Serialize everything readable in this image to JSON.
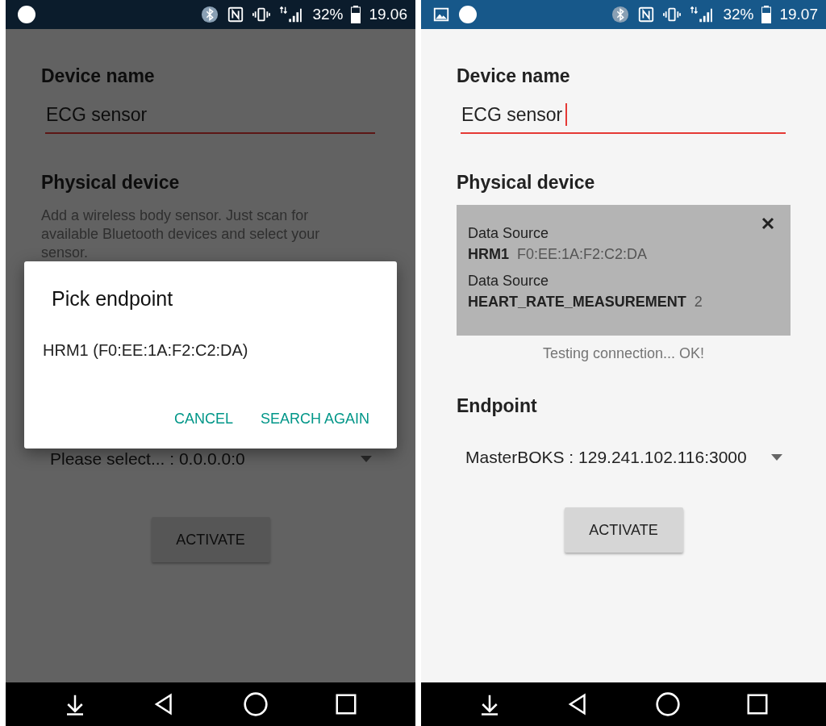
{
  "screens": [
    {
      "dimmed": true,
      "status_bar": {
        "notification_icons": [
          {
            "kind": "circle"
          }
        ],
        "battery": "32%",
        "time": "19.06"
      },
      "form": {
        "name_label": "Device name",
        "name_value": "ECG sensor",
        "name_focused": false,
        "physical_label": "Physical device",
        "physical_hint": "Add a wireless body sensor. Just scan for available Bluetooth devices and select your sensor.",
        "endpoint_value": "Please select... : 0.0.0.0:0",
        "activate_button": "ACTIVATE"
      },
      "dialog": {
        "title": "Pick endpoint",
        "items": [
          "HRM1 (F0:EE:1A:F2:C2:DA)"
        ],
        "buttons": [
          "CANCEL",
          "SEARCH AGAIN"
        ]
      }
    },
    {
      "dimmed": false,
      "status_bar": {
        "notification_icons": [
          {
            "kind": "image"
          },
          {
            "kind": "circle"
          }
        ],
        "battery": "32%",
        "time": "19.07"
      },
      "form": {
        "name_label": "Device name",
        "name_value": "ECG sensor",
        "name_focused": true,
        "physical_label": "Physical device",
        "sensor_card": {
          "sources": [
            {
              "label": "Data Source",
              "name": "HRM1",
              "detail": "F0:EE:1A:F2:C2:DA"
            },
            {
              "label": "Data Source",
              "name": "HEART_RATE_MEASUREMENT",
              "detail": "2"
            }
          ]
        },
        "connection_status": "Testing connection... OK!",
        "endpoint_label": "Endpoint",
        "endpoint_value": "MasterBOKS : 129.241.102.116:3000",
        "activate_button": "ACTIVATE"
      }
    }
  ]
}
